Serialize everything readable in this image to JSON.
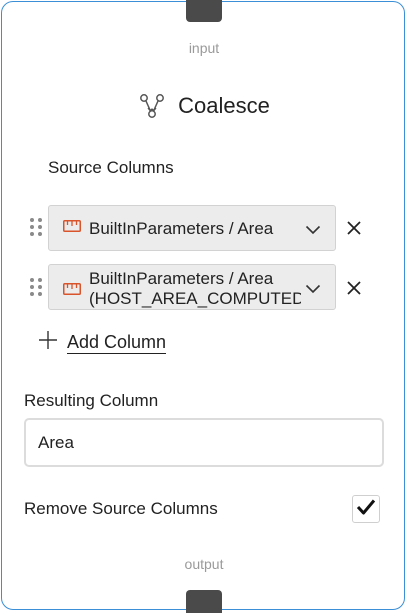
{
  "node": {
    "input_label": "input",
    "output_label": "output",
    "title": "Coalesce",
    "title_icon": "merge-icon"
  },
  "source_columns": {
    "label": "Source Columns",
    "items": [
      {
        "line1": "BuiltInParameters / Area",
        "line2": "",
        "type_icon": "ruler-icon"
      },
      {
        "line1": "BuiltInParameters / Area",
        "line2": "(HOST_AREA_COMPUTED",
        "type_icon": "ruler-icon"
      }
    ],
    "add_label": "Add Column"
  },
  "resulting_column": {
    "label": "Resulting Column",
    "value": "Area"
  },
  "remove_source": {
    "label": "Remove Source Columns",
    "checked": true
  },
  "colors": {
    "border": "#3b8fd6",
    "port": "#4a4a4a",
    "ruler_icon": "#d9542b"
  }
}
